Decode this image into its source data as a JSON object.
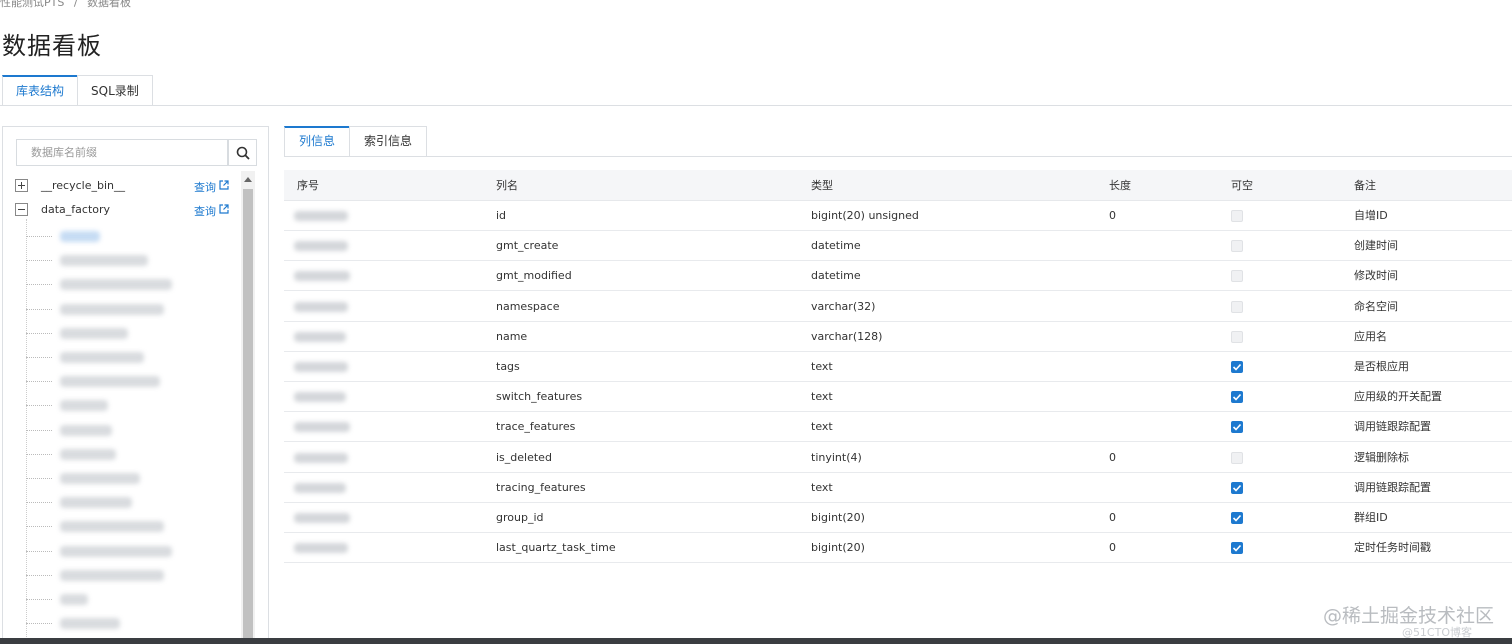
{
  "breadcrumb": {
    "item1": "性能测试PTS",
    "separator": "/",
    "item2": "数据看板"
  },
  "page": {
    "title": "数据看板"
  },
  "top_tabs": [
    {
      "label": "库表结构"
    },
    {
      "label": "SQL录制"
    }
  ],
  "left_panel": {
    "search": {
      "placeholder": "数据库名前缀"
    },
    "tree": [
      {
        "label": "__recycle_bin__",
        "action": "查询",
        "expanded": false
      },
      {
        "label": "data_factory",
        "action": "查询",
        "expanded": true
      }
    ]
  },
  "right_tabs": [
    {
      "label": "列信息"
    },
    {
      "label": "索引信息"
    }
  ],
  "table": {
    "headers": {
      "seq": "序号",
      "name": "列名",
      "type": "类型",
      "length": "长度",
      "nullable": "可空",
      "comment": "备注"
    },
    "rows": [
      {
        "name": "id",
        "type": "bigint(20) unsigned",
        "length": "0",
        "nullable": false,
        "comment": "自增ID"
      },
      {
        "name": "gmt_create",
        "type": "datetime",
        "length": "",
        "nullable": false,
        "comment": "创建时间"
      },
      {
        "name": "gmt_modified",
        "type": "datetime",
        "length": "",
        "nullable": false,
        "comment": "修改时间"
      },
      {
        "name": "namespace",
        "type": "varchar(32)",
        "length": "",
        "nullable": false,
        "comment": "命名空间"
      },
      {
        "name": "name",
        "type": "varchar(128)",
        "length": "",
        "nullable": false,
        "comment": "应用名"
      },
      {
        "name": "tags",
        "type": "text",
        "length": "",
        "nullable": true,
        "comment": "是否根应用"
      },
      {
        "name": "switch_features",
        "type": "text",
        "length": "",
        "nullable": true,
        "comment": "应用级的开关配置"
      },
      {
        "name": "trace_features",
        "type": "text",
        "length": "",
        "nullable": true,
        "comment": "调用链跟踪配置"
      },
      {
        "name": "is_deleted",
        "type": "tinyint(4)",
        "length": "0",
        "nullable": false,
        "comment": "逻辑删除标"
      },
      {
        "name": "tracing_features",
        "type": "text",
        "length": "",
        "nullable": true,
        "comment": "调用链跟踪配置"
      },
      {
        "name": "group_id",
        "type": "bigint(20)",
        "length": "0",
        "nullable": true,
        "comment": "群组ID"
      },
      {
        "name": "last_quartz_task_time",
        "type": "bigint(20)",
        "length": "0",
        "nullable": true,
        "comment": "定时任务时间戳"
      }
    ]
  },
  "watermark": {
    "text": "@稀土掘金技术社区",
    "sub": "@51CTO博客"
  },
  "colors": {
    "accent": "#1d79cf",
    "border": "#dcdfe3",
    "header_bg": "#f5f6f8"
  }
}
